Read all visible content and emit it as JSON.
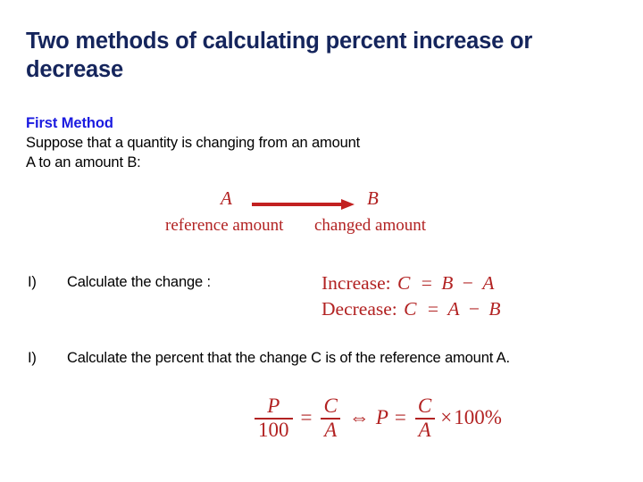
{
  "slide": {
    "title": "Two methods of calculating percent increase or decrease",
    "background_color": "#ffffff",
    "title_color": "#15255c",
    "subhead_color": "#1a1ae0",
    "math_color": "#b22222",
    "body_color": "#000000"
  },
  "body": {
    "subhead": "First Method",
    "intro_line_1": "Suppose that a quantity is changing from an amount",
    "intro_line_2": "A to an amount B:"
  },
  "diagram": {
    "from_label": "A",
    "to_label": "B",
    "from_caption": "reference amount",
    "to_caption": "changed amount",
    "arrow_icon": "right-arrow-icon"
  },
  "steps": [
    {
      "marker": "I)",
      "text": "Calculate the change :"
    },
    {
      "marker": "I)",
      "text": "Calculate the percent that the change C is of the reference amount A."
    }
  ],
  "equations": {
    "increase_label": "Increase:",
    "increase_lhs": "C",
    "increase_eq": "=",
    "increase_rhs_1": "B",
    "increase_minus": "−",
    "increase_rhs_2": "A",
    "decrease_label": "Decrease:",
    "decrease_lhs": "C",
    "decrease_eq": "=",
    "decrease_rhs_1": "A",
    "decrease_minus": "−",
    "decrease_rhs_2": "B",
    "percent": {
      "f1_num": "P",
      "f1_den": "100",
      "equals_1": "=",
      "f2_num": "C",
      "f2_den": "A",
      "iff": "⇔",
      "p_var": "P",
      "equals_2": "=",
      "f3_num": "C",
      "f3_den": "A",
      "times": "×",
      "hundred_percent": "100%"
    }
  }
}
